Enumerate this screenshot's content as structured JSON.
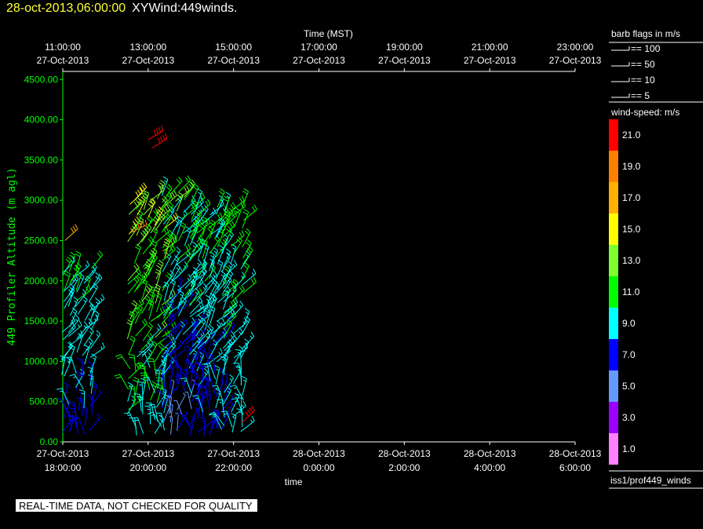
{
  "header": {
    "datetime": "28-oct-2013,06:00:00",
    "title": "XYWind:449winds."
  },
  "notice": "REAL-TIME DATA, NOT CHECKED FOR QUALITY",
  "legend": {
    "barb_title": "barb flags in m/s",
    "barbs": [
      "== 100",
      "== 50",
      "== 10",
      "== 5"
    ],
    "speed_title": "wind-speed: m/s",
    "scale": [
      {
        "label": "21.0",
        "color": "#ff0000"
      },
      {
        "label": "19.0",
        "color": "#ff8000"
      },
      {
        "label": "17.0",
        "color": "#ffb000"
      },
      {
        "label": "15.0",
        "color": "#ffff00"
      },
      {
        "label": "13.0",
        "color": "#80ff30"
      },
      {
        "label": "11.0",
        "color": "#00ff00"
      },
      {
        "label": "9.0",
        "color": "#00ffff"
      },
      {
        "label": "7.0",
        "color": "#0000ff"
      },
      {
        "label": "5.0",
        "color": "#6699ff"
      },
      {
        "label": "3.0",
        "color": "#9900ff"
      },
      {
        "label": "1.0",
        "color": "#ff80ff"
      }
    ],
    "source": "iss1/prof449_winds"
  },
  "chart_data": {
    "type": "wind-barb",
    "ylabel": "449 Profiler Altitude (m agl)",
    "ylim": [
      0,
      4600
    ],
    "yticks": [
      "0.00",
      "500.00",
      "1000.00",
      "1500.00",
      "2000.00",
      "2500.00",
      "3000.00",
      "3500.00",
      "4000.00",
      "4500.00"
    ],
    "xlabel_bottom": "time",
    "xticks_bottom": [
      [
        "27-Oct-2013",
        "18:00:00"
      ],
      [
        "27-Oct-2013",
        "20:00:00"
      ],
      [
        "27-Oct-2013",
        "22:00:00"
      ],
      [
        "28-Oct-2013",
        "0:00:00"
      ],
      [
        "28-Oct-2013",
        "2:00:00"
      ],
      [
        "28-Oct-2013",
        "4:00:00"
      ],
      [
        "28-Oct-2013",
        "6:00:00"
      ]
    ],
    "xlabel_top": "Time (MST)",
    "xticks_top": [
      [
        "11:00:00",
        "27-Oct-2013"
      ],
      [
        "13:00:00",
        "27-Oct-2013"
      ],
      [
        "15:00:00",
        "27-Oct-2013"
      ],
      [
        "17:00:00",
        "27-Oct-2013"
      ],
      [
        "19:00:00",
        "27-Oct-2013"
      ],
      [
        "21:00:00",
        "27-Oct-2013"
      ],
      [
        "23:00:00",
        "27-Oct-2013"
      ]
    ],
    "xlim_hours_utc": [
      18,
      30
    ],
    "barb_columns": [
      {
        "t": [
          18.0,
          18.65
        ],
        "zmax": 2150,
        "cmin": 6,
        "cmax": 11
      },
      {
        "t": [
          19.55,
          20.35
        ],
        "zmax": 3000,
        "cmin": 6,
        "cmax": 16
      },
      {
        "t": [
          20.35,
          21.0
        ],
        "zmax": 3150,
        "cmin": 3,
        "cmax": 13
      },
      {
        "t": [
          21.0,
          21.75
        ],
        "zmax": 2950,
        "cmin": 5,
        "cmax": 12
      },
      {
        "t": [
          21.75,
          22.2
        ],
        "zmax": 2900,
        "cmin": 7,
        "cmax": 12
      }
    ],
    "highlights": [
      {
        "t": 20.0,
        "z": 3750,
        "speed": 21
      },
      {
        "t": 20.1,
        "z": 3650,
        "speed": 21
      },
      {
        "t": 19.6,
        "z": 2600,
        "speed": 19
      },
      {
        "t": 22.2,
        "z": 240,
        "speed": 21
      },
      {
        "t": 18.05,
        "z": 2500,
        "speed": 17
      }
    ]
  }
}
